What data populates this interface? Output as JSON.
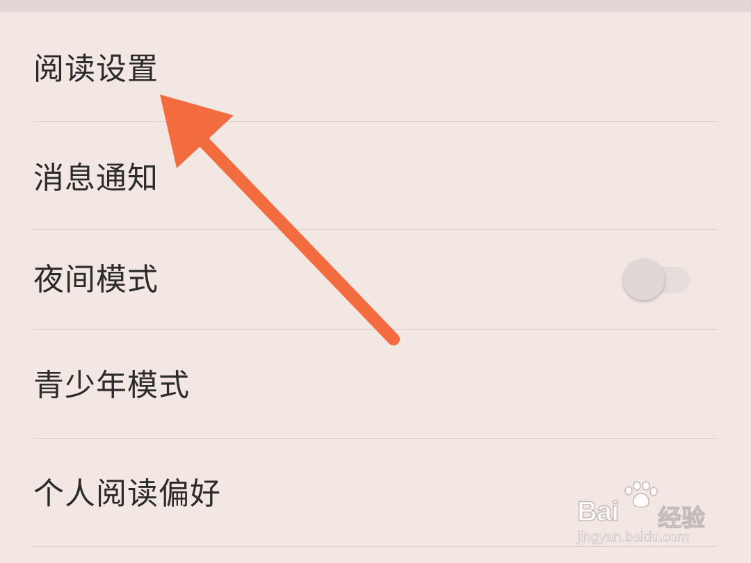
{
  "settings": {
    "items": [
      {
        "label": "阅读设置"
      },
      {
        "label": "消息通知"
      },
      {
        "label": "夜间模式",
        "toggle": {
          "state": "off"
        }
      },
      {
        "label": "青少年模式"
      },
      {
        "label": "个人阅读偏好"
      }
    ]
  },
  "annotation": {
    "arrow_color": "#f36c40"
  },
  "watermark": {
    "brand": "Bai",
    "brand_suffix": "经验",
    "url": "jingyan.baidu.com"
  }
}
